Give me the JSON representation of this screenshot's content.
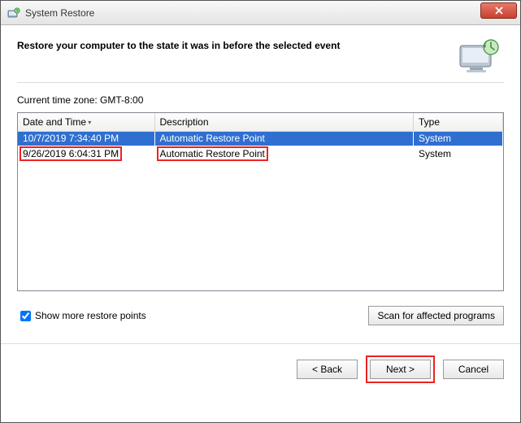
{
  "window": {
    "title": "System Restore"
  },
  "header": {
    "heading": "Restore your computer to the state it was in before the selected event"
  },
  "timezone_label": "Current time zone: GMT-8:00",
  "columns": {
    "date": "Date and Time",
    "desc": "Description",
    "type": "Type"
  },
  "rows": [
    {
      "date": "10/7/2019 7:34:40 PM",
      "desc": "Automatic Restore Point",
      "type": "System",
      "selected": true
    },
    {
      "date": "9/26/2019 6:04:31 PM",
      "desc": "Automatic Restore Point",
      "type": "System",
      "selected": false,
      "annot": true
    }
  ],
  "show_more_label": "Show more restore points",
  "show_more_checked": true,
  "scan_button": "Scan for affected programs",
  "buttons": {
    "back": "< Back",
    "next": "Next >",
    "cancel": "Cancel"
  }
}
